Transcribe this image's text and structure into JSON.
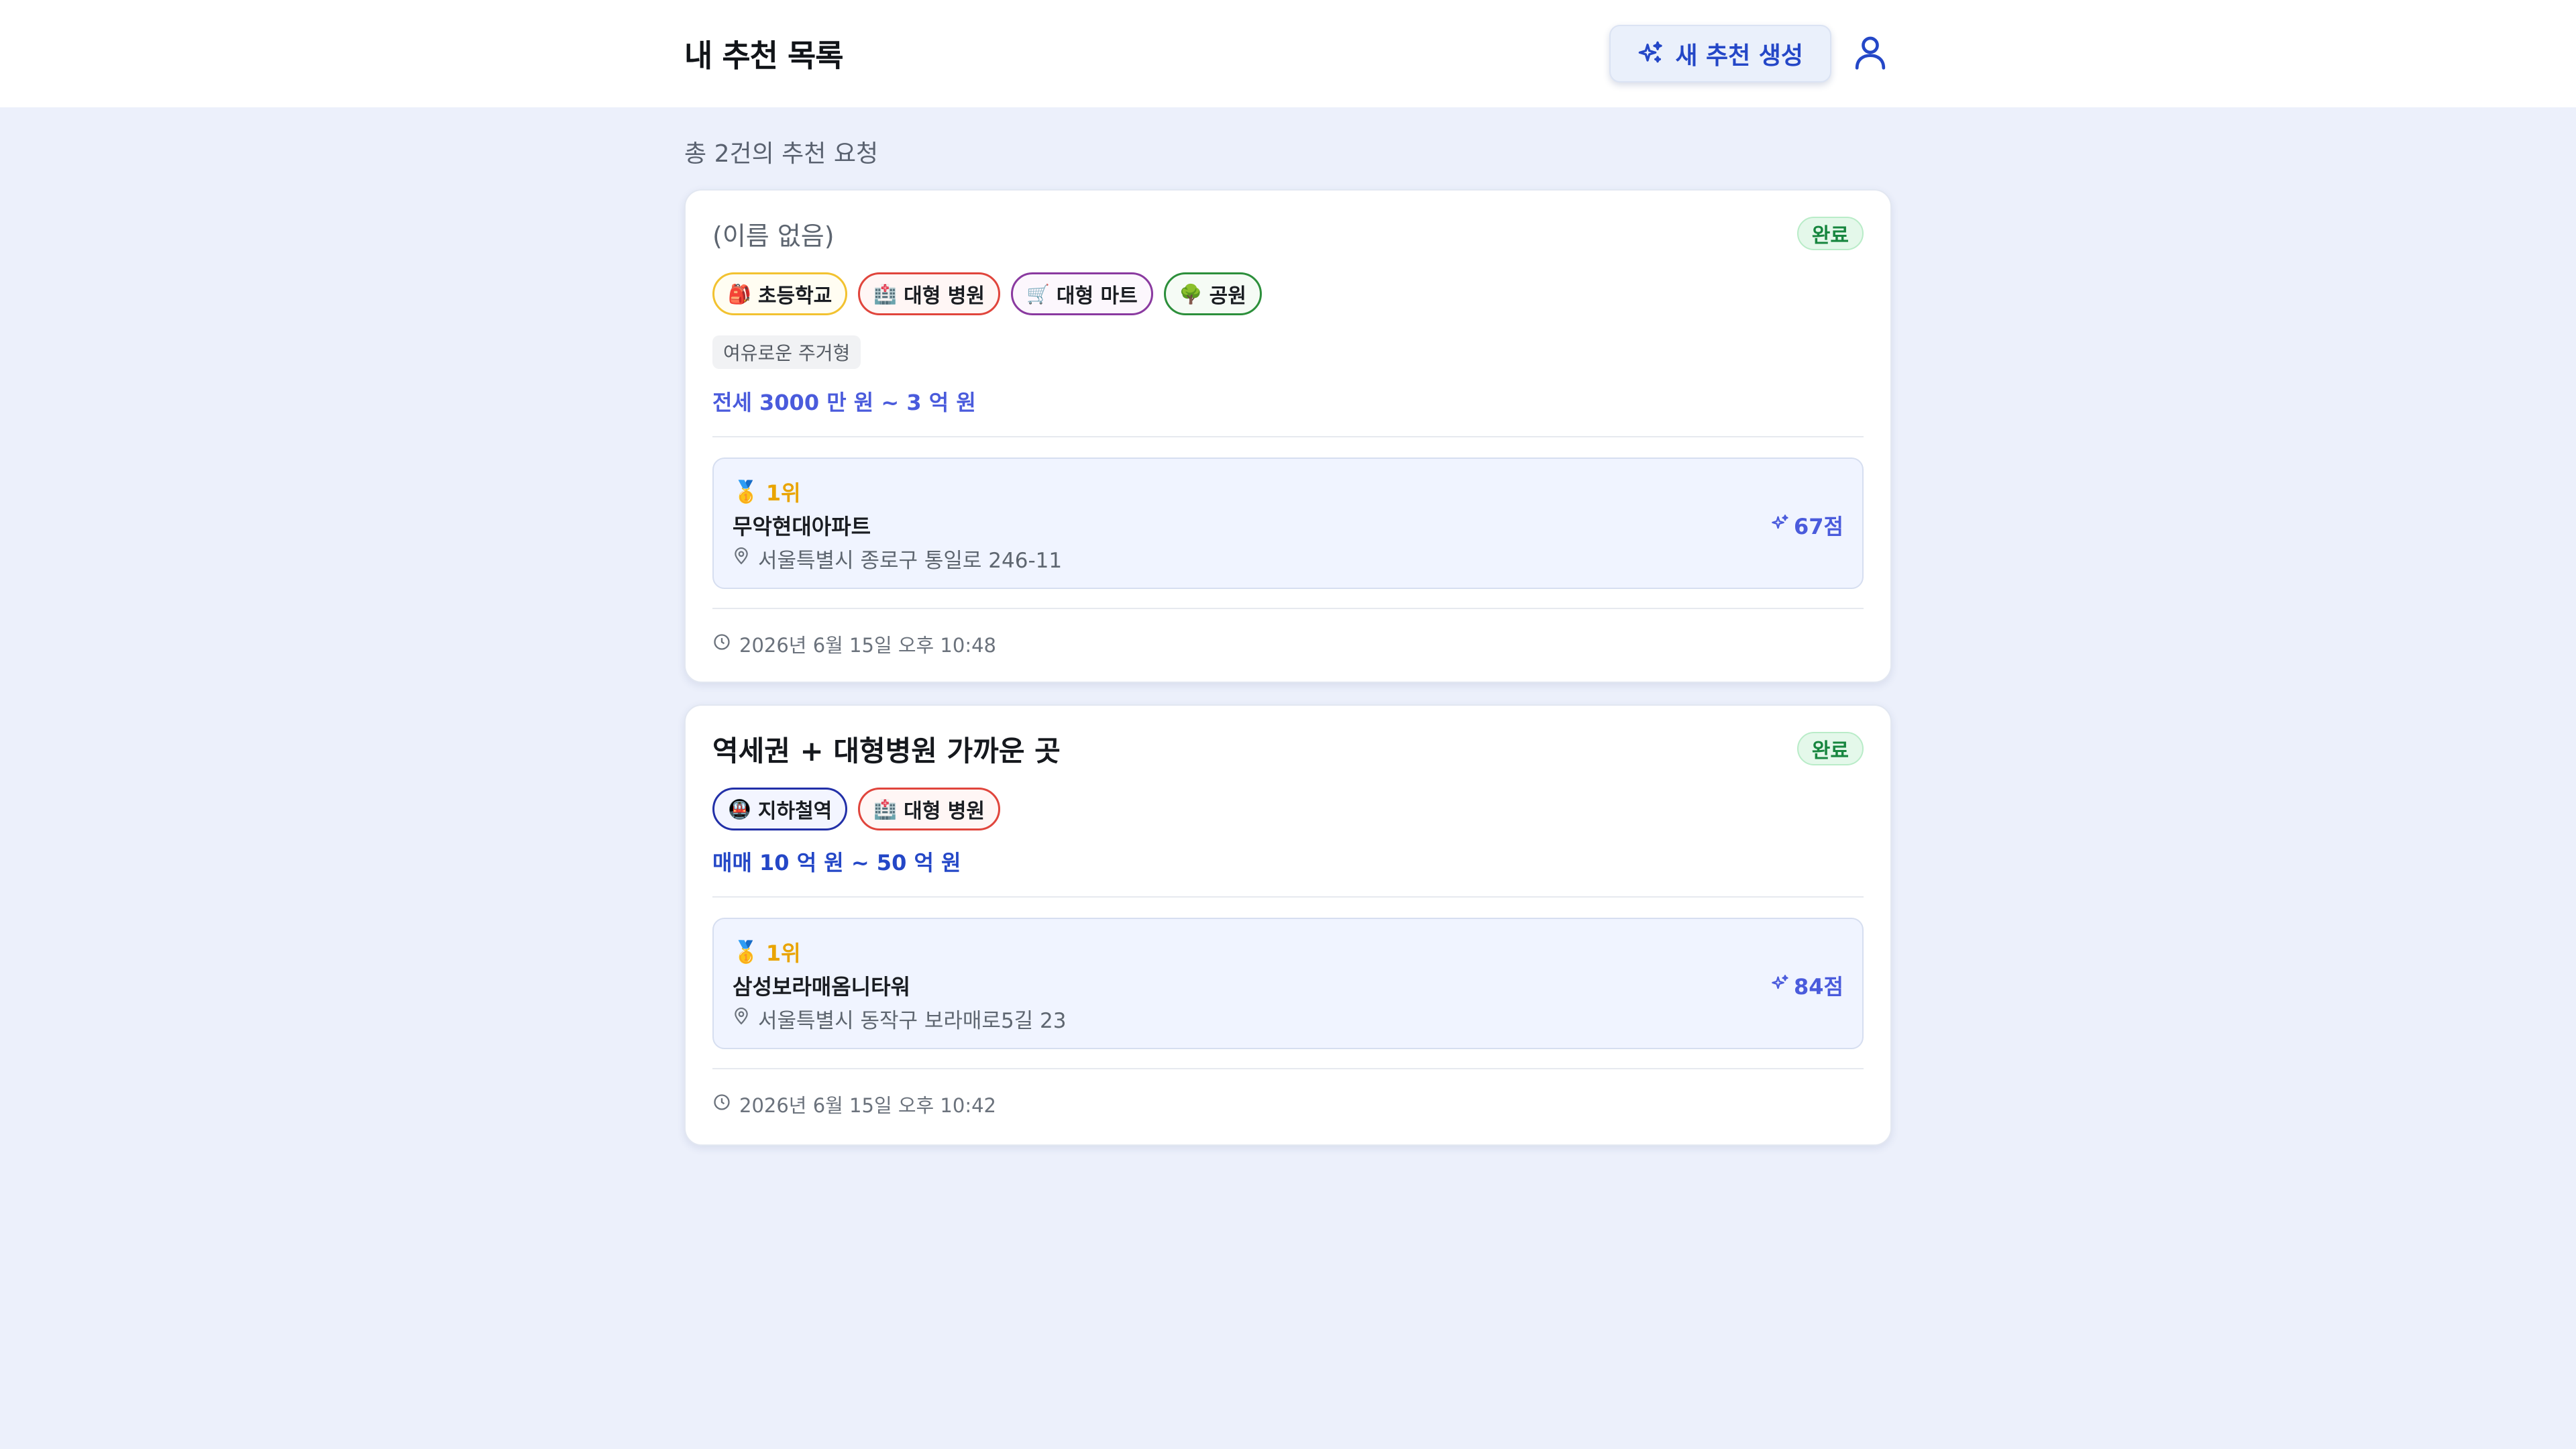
{
  "header": {
    "title": "내 추천 목록",
    "new_button_label": "새 추천 생성",
    "new_button_icon": "sparkles-icon",
    "user_icon": "user-icon"
  },
  "summary": "총 2건의 추천 요청",
  "colors": {
    "accent": "#2447c7",
    "background": "#ecf0fb",
    "status_done": "#17863f",
    "rank_gold": "#e9a400"
  },
  "cards": [
    {
      "title": "(이름 없음)",
      "status": "완료",
      "tags": [
        {
          "emoji": "🎒",
          "label": "초등학교"
        },
        {
          "emoji": "🏥",
          "label": "대형 병원"
        },
        {
          "emoji": "🛒",
          "label": "대형 마트"
        },
        {
          "emoji": "🌳",
          "label": "공원"
        }
      ],
      "type": "여유로운 주거형",
      "price": "전세 3000 만 원 ~ 3 억 원",
      "result": {
        "rank_emoji": "🥇",
        "rank": "1위",
        "name": "무악현대아파트",
        "address": "서울특별시 종로구 통일로 246-11",
        "score": "67점"
      },
      "timestamp": "2026년 6월 15일 오후 10:48"
    },
    {
      "title": "역세권 + 대형병원 가까운 곳",
      "status": "완료",
      "tags": [
        {
          "emoji": "🚇",
          "label": "지하철역"
        },
        {
          "emoji": "🏥",
          "label": "대형 병원"
        }
      ],
      "price": "매매 10 억 원 ~ 50 억 원",
      "result": {
        "rank_emoji": "🥇",
        "rank": "1위",
        "name": "삼성보라매옴니타워",
        "address": "서울특별시 동작구 보라매로5길 23",
        "score": "84점"
      },
      "timestamp": "2026년 6월 15일 오후 10:42"
    }
  ]
}
